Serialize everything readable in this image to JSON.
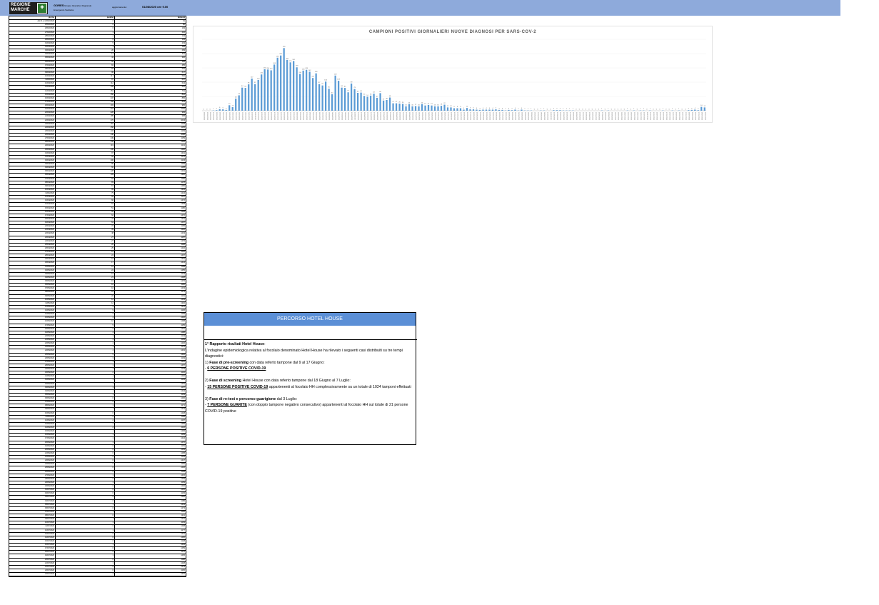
{
  "header": {
    "logo_text": "REGIONE MARCHE",
    "org_name": "GORES",
    "org_desc": "Gruppo Operativo Regionale",
    "org_sub": "Emergenza Sanitaria",
    "update_label": "aggiornamento:",
    "update_date": "01/08/2020 ore 9.00"
  },
  "table": {
    "headers": [
      "giorno",
      "positivi",
      "tamponi"
    ],
    "first_label": "dal 01 al 23/02/2020",
    "start_date": "24/02/2020",
    "rows_count": 157,
    "positives": [
      0,
      0,
      0,
      1,
      2,
      6,
      5,
      3,
      20,
      13,
      44,
      56,
      84,
      83,
      96,
      117,
      97,
      112,
      132,
      151,
      150,
      147,
      168,
      193,
      201,
      228,
      185,
      176,
      181,
      158,
      134,
      146,
      149,
      142,
      119,
      136,
      97,
      92,
      106,
      80,
      60,
      128,
      109,
      84,
      83,
      67,
      99,
      79,
      65,
      66,
      54,
      51,
      55,
      62,
      47,
      64,
      37,
      39,
      48,
      27,
      27,
      26,
      25,
      16,
      24,
      16,
      17,
      16,
      24,
      19,
      21,
      19,
      16,
      16,
      18,
      22,
      12,
      12,
      9,
      9,
      9,
      4,
      10,
      5,
      5,
      4,
      3,
      4,
      4,
      4,
      4,
      5,
      3,
      3,
      1,
      3,
      2,
      4,
      1,
      4,
      1,
      1,
      1,
      0,
      0,
      1,
      1,
      0,
      0,
      2,
      2,
      2,
      1,
      1,
      1,
      1,
      0,
      0,
      0,
      0,
      0,
      0,
      0,
      0,
      1,
      0,
      1,
      0,
      0,
      0,
      0,
      0,
      1,
      0,
      1,
      0,
      1,
      1,
      0,
      1,
      0,
      0,
      0,
      1,
      0,
      0,
      1,
      0,
      1,
      0,
      0,
      2,
      3,
      4,
      2,
      14,
      12
    ],
    "tests": [
      61,
      80,
      129,
      232,
      143,
      164,
      233,
      268,
      299,
      321,
      340,
      498,
      455,
      525,
      617,
      562,
      667,
      644,
      610,
      731,
      842,
      865,
      849,
      956,
      1006,
      984,
      958,
      1043,
      1128,
      1105,
      1154,
      1088,
      1159,
      1206,
      1141,
      1296,
      1311,
      1176,
      1123,
      1184,
      1158,
      1201,
      1300,
      1196,
      1178,
      1250,
      1304,
      1224,
      1157,
      1272,
      1328,
      1180,
      1238,
      1270,
      1211,
      1297,
      1165,
      1202,
      1243,
      1187,
      1276,
      1198,
      1232,
      1140,
      1267,
      1301,
      1214,
      1189,
      1255,
      1143,
      1208,
      1276,
      1190,
      1233,
      1174,
      1161,
      1249,
      1302,
      1211,
      1136,
      1183,
      1240,
      1268,
      1155,
      1207,
      1288,
      1143,
      1199,
      1226,
      1175,
      1231,
      1262,
      1149,
      1210,
      1257,
      1178,
      1132,
      1220,
      1193,
      1251,
      1167,
      1244,
      1139,
      1206,
      1289,
      1171,
      1213,
      1248,
      1158,
      1197,
      1265,
      1142,
      1236,
      1183,
      1224,
      1270,
      1151,
      1209,
      1258,
      1164,
      1227,
      1181,
      1246,
      1138,
      1215,
      1293,
      1169,
      1202,
      1252,
      1145,
      1230,
      1186,
      1219,
      1273,
      1156,
      1211,
      1247,
      1163,
      1238,
      1177,
      1221,
      1266,
      1148,
      1204,
      1259,
      1172,
      1235,
      1188,
      1228,
      1279,
      1152,
      1207,
      1243,
      1166,
      1232,
      1181,
      1225
    ]
  },
  "chart_data": {
    "type": "bar",
    "title": "CAMPIONI POSITIVI GIORNALIERI NUOVE DIAGNOSI PER SARS-COV-2",
    "start_date": "24/02/2020",
    "values": [
      0,
      0,
      0,
      1,
      2,
      6,
      5,
      3,
      20,
      13,
      44,
      56,
      84,
      83,
      96,
      117,
      97,
      112,
      132,
      151,
      150,
      147,
      168,
      193,
      201,
      228,
      185,
      176,
      181,
      158,
      134,
      146,
      149,
      142,
      119,
      136,
      97,
      92,
      106,
      80,
      60,
      128,
      109,
      84,
      83,
      67,
      99,
      79,
      65,
      66,
      54,
      51,
      55,
      62,
      47,
      64,
      37,
      39,
      48,
      27,
      27,
      26,
      25,
      16,
      24,
      16,
      17,
      16,
      24,
      19,
      21,
      19,
      16,
      16,
      18,
      22,
      12,
      12,
      9,
      9,
      9,
      4,
      10,
      5,
      5,
      4,
      3,
      4,
      4,
      4,
      4,
      5,
      3,
      3,
      1,
      3,
      2,
      4,
      1,
      4,
      1,
      1,
      1,
      0,
      0,
      1,
      1,
      0,
      0,
      2,
      2,
      2,
      1,
      1,
      1,
      1,
      0,
      0,
      0,
      0,
      0,
      0,
      0,
      0,
      1,
      0,
      1,
      0,
      0,
      0,
      0,
      0,
      1,
      0,
      1,
      0,
      1,
      1,
      0,
      1,
      0,
      0,
      0,
      1,
      0,
      0,
      1,
      0,
      1,
      0,
      0,
      2,
      3,
      4,
      2,
      14,
      12
    ],
    "ylim": [
      0,
      260
    ],
    "bar_color": "#5b9bd5",
    "grid": true,
    "legend": "none"
  },
  "hotel_house": {
    "title": "PERCORSO HOTEL HOUSE",
    "heading": "1° Rapporto  risultati Hotel House",
    "intro": "L'indagine epidemiologica relativa al focolaio denominato Hotel House ha rilevato i seguenti casi distribuiti su tre tempi diagnostici:",
    "phase1_num": "1)",
    "phase1_bold": "Fase di pre-screening",
    "phase1_text": "con data referto tampone dal 9 al 17 Giugno:",
    "phase1_dash": "-",
    "phase1_result": "6 PERSONE POSITIVE COVID-19",
    "phase2_num": "2)",
    "phase2_bold": "Fase di screening",
    "phase2_text": "Hotel House con data referto tampone dal 18 Giugno al 7 Luglio:",
    "phase2_dash": "-",
    "phase2_result": "15 PERSONE POSITIVE COVID-19",
    "phase2_tail": "appartenenti al focolaio HH complessivamente su un totale di 1024 tamponi effettuati",
    "phase3_num": "3)",
    "phase3_bold": "Fase di re-test e percorso guarigione",
    "phase3_text": "dal 3 Luglio:",
    "phase3_dash": "-",
    "phase3_result": "7 PERSONE GUARITE",
    "phase3_tail": "(con doppio tampone negativo consecutivo) appartenenti al focolaio HH sul totale di 21 persone COVID-19 positive"
  }
}
